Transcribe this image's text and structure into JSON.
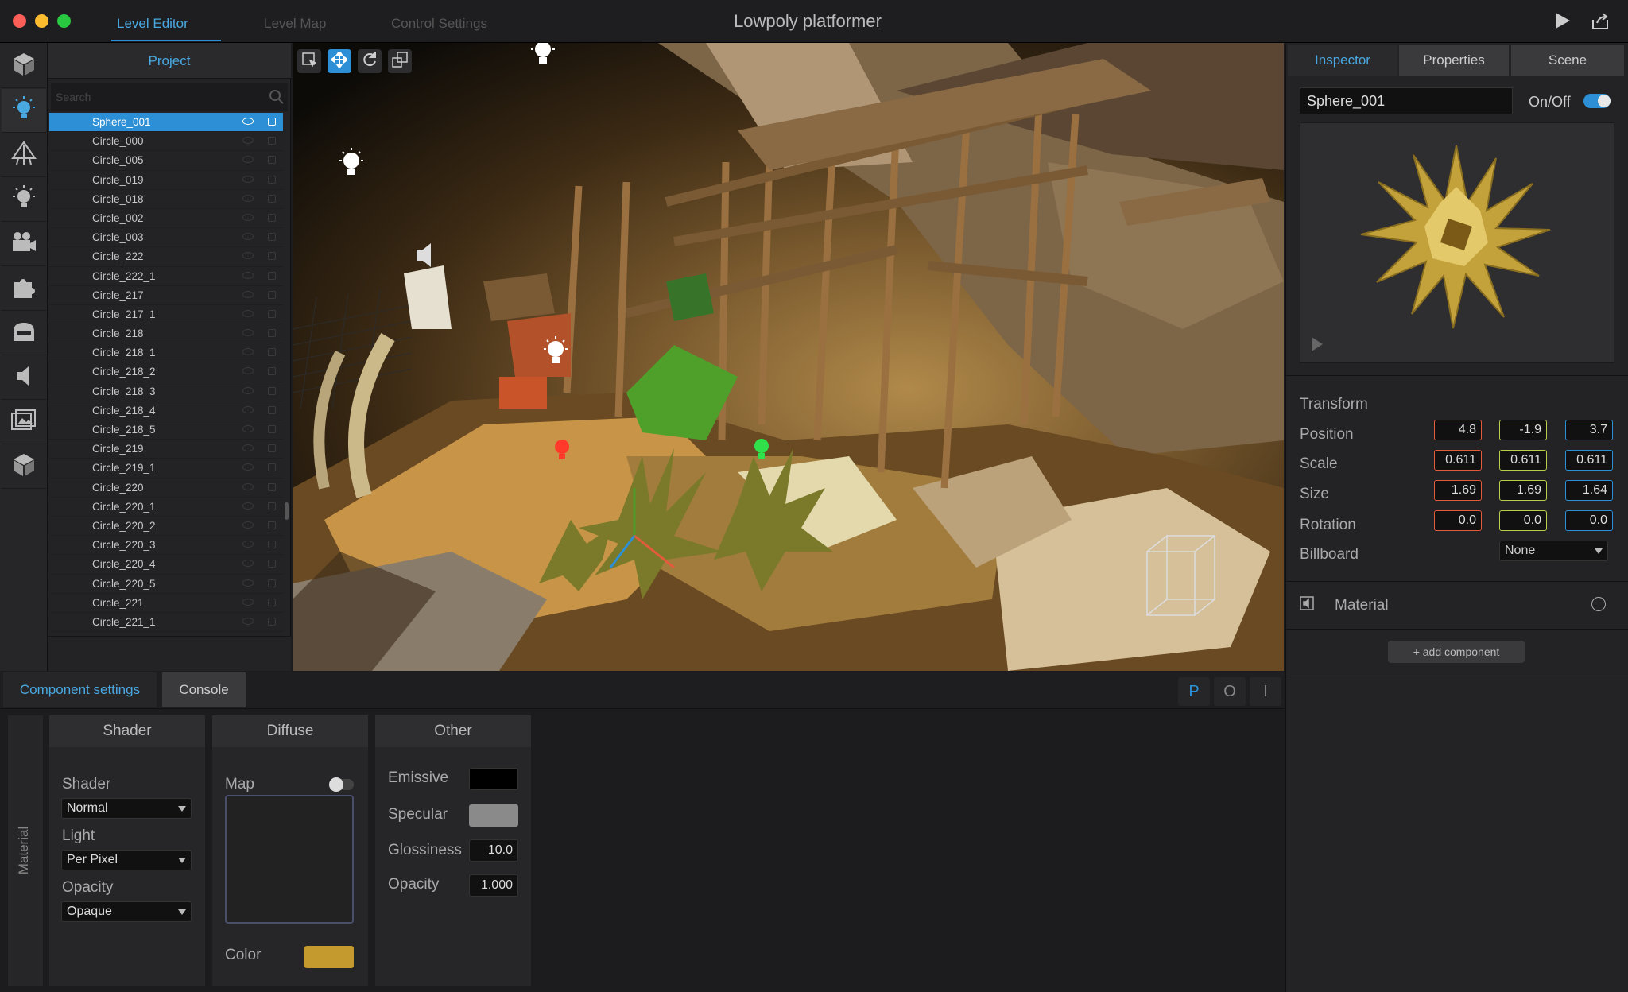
{
  "window": {
    "title": "Lowpoly platformer",
    "tabs": [
      "Level Editor",
      "Level Map",
      "Control Settings"
    ]
  },
  "project": {
    "header": "Project",
    "search_placeholder": "Search",
    "items": [
      "Sphere_001",
      "Circle_000",
      "Circle_005",
      "Circle_019",
      "Circle_018",
      "Circle_002",
      "Circle_003",
      "Circle_222",
      "Circle_222_1",
      "Circle_217",
      "Circle_217_1",
      "Circle_218",
      "Circle_218_1",
      "Circle_218_2",
      "Circle_218_3",
      "Circle_218_4",
      "Circle_218_5",
      "Circle_219",
      "Circle_219_1",
      "Circle_220",
      "Circle_220_1",
      "Circle_220_2",
      "Circle_220_3",
      "Circle_220_4",
      "Circle_220_5",
      "Circle_221",
      "Circle_221_1"
    ],
    "selected": "Sphere_001"
  },
  "inspector": {
    "tabs": [
      "Inspector",
      "Properties",
      "Scene"
    ],
    "object_name": "Sphere_001",
    "onoff_label": "On/Off",
    "enabled": true,
    "transform_label": "Transform",
    "rows": [
      {
        "label": "Position",
        "values": [
          "4.8",
          "-1.9",
          "3.7"
        ]
      },
      {
        "label": "Scale",
        "values": [
          "0.611",
          "0.611",
          "0.611"
        ]
      },
      {
        "label": "Size",
        "values": [
          "1.69",
          "1.69",
          "1.64"
        ]
      },
      {
        "label": "Rotation",
        "values": [
          "0.0",
          "0.0",
          "0.0"
        ]
      }
    ],
    "billboard_label": "Billboard",
    "billboard_value": "None",
    "material_label": "Material",
    "add_component": "+ add component"
  },
  "bottom": {
    "tabs": [
      "Component settings",
      "Console"
    ],
    "mode_buttons": [
      "P",
      "O",
      "I"
    ],
    "side_label": "Material",
    "shader": {
      "header": "Shader",
      "shader_label": "Shader",
      "shader_value": "Normal",
      "light_label": "Light",
      "light_value": "Per Pixel",
      "opacity_label": "Opacity",
      "opacity_value": "Opaque"
    },
    "diffuse": {
      "header": "Diffuse",
      "map_label": "Map",
      "color_label": "Color",
      "color": "#c49a2f"
    },
    "other": {
      "header": "Other",
      "emissive_label": "Emissive",
      "emissive_color": "#000000",
      "specular_label": "Specular",
      "specular_color": "#8a8a8a",
      "glossiness_label": "Glossiness",
      "glossiness_value": "10.0",
      "opacity_label": "Opacity",
      "opacity_value": "1.000"
    }
  },
  "colors": {
    "accent": "#2d8fd5",
    "x_axis": "#e45b3c",
    "y_axis": "#b6d04a",
    "z_axis": "#2d8fd5"
  }
}
